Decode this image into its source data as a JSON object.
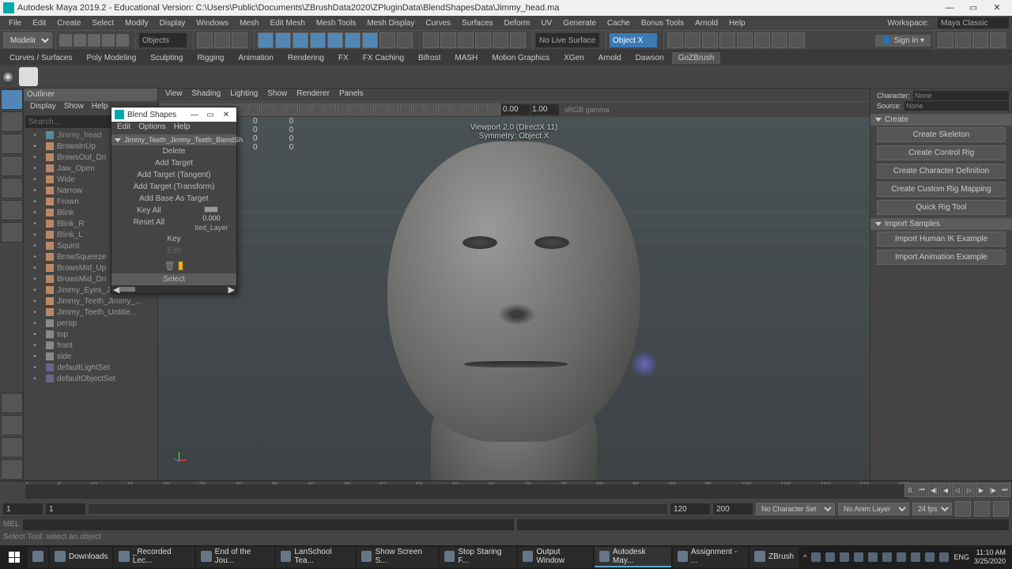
{
  "titlebar": {
    "title": "Autodesk Maya 2019.2 - Educational Version: C:\\Users\\Public\\Documents\\ZBrushData2020\\ZPluginData\\BlendShapesData\\Jimmy_head.ma"
  },
  "menubar": {
    "items": [
      "File",
      "Edit",
      "Create",
      "Select",
      "Modify",
      "Display",
      "Windows",
      "Mesh",
      "Edit Mesh",
      "Mesh Tools",
      "Mesh Display",
      "Curves",
      "Surfaces",
      "Deform",
      "UV",
      "Generate",
      "Cache",
      "Bonus Tools",
      "Arnold",
      "Help"
    ],
    "workspace_label": "Workspace:",
    "workspace_value": "Maya Classic"
  },
  "shelf_top": {
    "mode": "Modeling",
    "objects_label": "Objects",
    "live_label": "No Live Surface",
    "sym_label": "Object X",
    "signin": "Sign in"
  },
  "shelf_tabs": [
    "Curves / Surfaces",
    "Poly Modeling",
    "Sculpting",
    "Rigging",
    "Animation",
    "Rendering",
    "FX",
    "FX Caching",
    "Bifrost",
    "MASH",
    "Motion Graphics",
    "XGen",
    "Arnold",
    "Dawson",
    "GoZBrush"
  ],
  "active_shelf_tab": "GoZBrush",
  "outliner": {
    "title": "Outliner",
    "menu": [
      "Display",
      "Show",
      "Help"
    ],
    "search_placeholder": "Search...",
    "items": [
      {
        "type": "mesh",
        "label": "Jimmy_head",
        "sel": true
      },
      {
        "type": "bs",
        "label": "BrowsInUp"
      },
      {
        "type": "bs",
        "label": "BrowsOut_Dn"
      },
      {
        "type": "bs",
        "label": "Jaw_Open"
      },
      {
        "type": "bs",
        "label": "Wide"
      },
      {
        "type": "bs",
        "label": "Narrow"
      },
      {
        "type": "bs",
        "label": "Frown"
      },
      {
        "type": "bs",
        "label": "Blink"
      },
      {
        "type": "bs",
        "label": "Blink_R"
      },
      {
        "type": "bs",
        "label": "Blink_L"
      },
      {
        "type": "bs",
        "label": "Squint"
      },
      {
        "type": "bs",
        "label": "BrowSqueeze"
      },
      {
        "type": "bs",
        "label": "BrowsMid_Up"
      },
      {
        "type": "bs",
        "label": "BrowsMid_Dn"
      },
      {
        "type": "bs",
        "label": "Jimmy_Eyes_Jimmy_E..."
      },
      {
        "type": "bs",
        "label": "Jimmy_Teeth_Jimmy_..."
      },
      {
        "type": "bs",
        "label": "Jimmy_Teeth_Untitle..."
      },
      {
        "type": "cam",
        "label": "persp"
      },
      {
        "type": "cam",
        "label": "top"
      },
      {
        "type": "cam",
        "label": "front"
      },
      {
        "type": "cam",
        "label": "side"
      },
      {
        "type": "set",
        "label": "defaultLightSet"
      },
      {
        "type": "set",
        "label": "defaultObjectSet"
      }
    ]
  },
  "viewport": {
    "menu": [
      "View",
      "Shading",
      "Lighting",
      "Show",
      "Renderer",
      "Panels"
    ],
    "overlay1": "Viewport 2.0 (DirectX 11)",
    "overlay2": "Symmetry: Object X",
    "time1": "0.00",
    "time2": "1.00",
    "gamma": "sRGB gamma",
    "nums": [
      [
        "0",
        "0"
      ],
      [
        "0",
        "0"
      ],
      [
        "0",
        "0"
      ],
      [
        "0",
        "0"
      ]
    ]
  },
  "blendshapes": {
    "title": "Blend Shapes",
    "menu": [
      "Edit",
      "Options",
      "Help"
    ],
    "node": "Jimmy_Teeth_Jimmy_Teeth_BlendSh",
    "actions": [
      "Delete",
      "Add Target",
      "Add Target (Tangent)",
      "Add Target (Transform)",
      "Add Base As Target",
      "Key All",
      "Reset All"
    ],
    "slider_val": "0.000",
    "layer": "tled_Layer",
    "key": "Key",
    "edit": "Edit",
    "select": "Select"
  },
  "right_panel": {
    "char_label": "Character:",
    "char_value": "None",
    "src_label": "Source:",
    "src_value": "None",
    "create_section": "Create",
    "create_btns": [
      "Create Skeleton",
      "Create Control Rig",
      "Create Character Definition",
      "Create Custom Rig Mapping",
      "Quick Rig Tool"
    ],
    "import_section": "Import Samples",
    "import_btns": [
      "Import Human IK Example",
      "Import Animation Example"
    ]
  },
  "timeslider": {
    "ticks": [
      "1",
      "5",
      "10",
      "15",
      "20",
      "25",
      "30",
      "35",
      "40",
      "45",
      "50",
      "55",
      "60",
      "65",
      "70",
      "75",
      "80",
      "85",
      "90",
      "95",
      "100",
      "105",
      "110",
      "115",
      "120"
    ],
    "current": "0"
  },
  "rangeslider": {
    "start_outer": "1",
    "start_inner": "1",
    "end_inner": "120",
    "end_outer": "200",
    "charset": "No Character Set",
    "animlayer": "No Anim Layer",
    "fps": "24 fps"
  },
  "cmdline": {
    "label": "MEL"
  },
  "helpline": {
    "text": "Select Tool: select an object"
  },
  "taskbar": {
    "items": [
      {
        "label": "Downloads"
      },
      {
        "label": "_Recorded Lec..."
      },
      {
        "label": "End of the Jou..."
      },
      {
        "label": "LanSchool Tea..."
      },
      {
        "label": "Show Screen S..."
      },
      {
        "label": "Stop Staring F..."
      },
      {
        "label": "Output Window"
      },
      {
        "label": "Autodesk May...",
        "active": true
      },
      {
        "label": "Assignment - ..."
      },
      {
        "label": "ZBrush"
      }
    ],
    "lang": "ENG",
    "time": "11:10 AM",
    "date": "3/25/2020"
  }
}
